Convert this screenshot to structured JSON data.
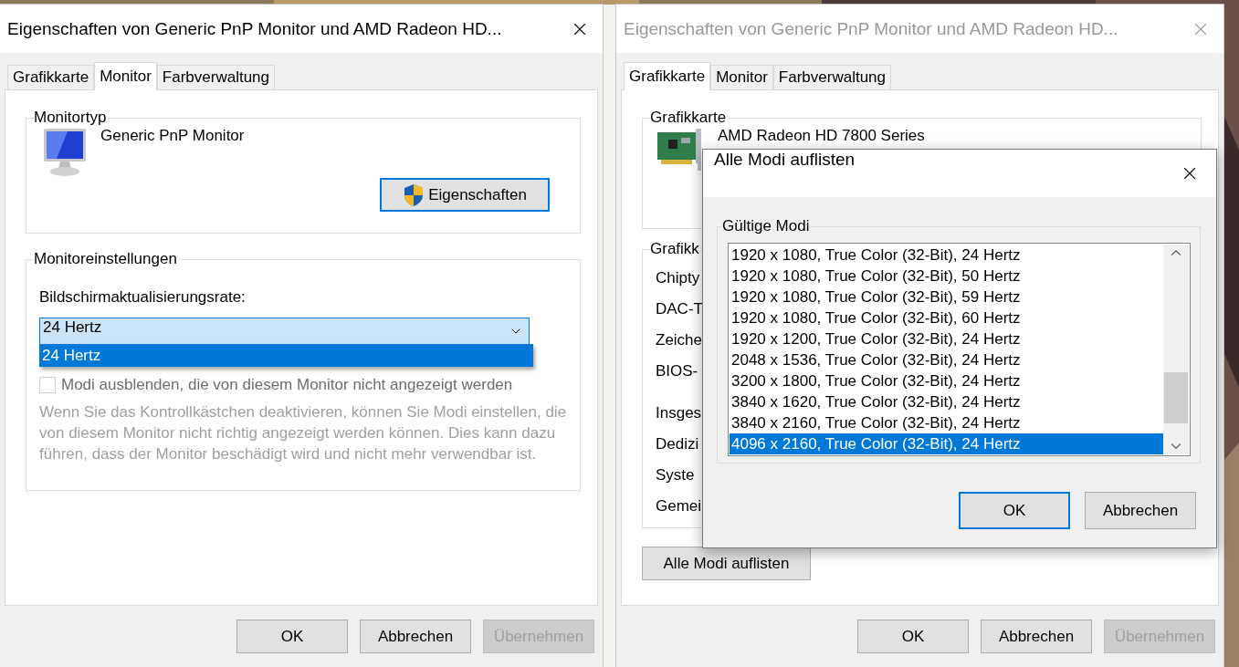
{
  "left_dialog": {
    "title": "Eigenschaften von Generic PnP Monitor und AMD Radeon HD...",
    "active": true,
    "tabs": [
      {
        "label": "Grafikkarte",
        "selected": false
      },
      {
        "label": "Monitor",
        "selected": true
      },
      {
        "label": "Farbverwaltung",
        "selected": false
      }
    ],
    "monitor_type": {
      "heading": "Monitortyp",
      "name": "Generic PnP Monitor",
      "button": {
        "label": "Eigenschaften",
        "focused": true
      }
    },
    "monitor_settings": {
      "heading": "Monitoreinstellungen",
      "refresh_label": "Bildschirmaktualisierungsrate:",
      "refresh_dropdown": {
        "value": "24 Hertz",
        "expanded": true,
        "options": [
          {
            "label": "24 Hertz",
            "selected": true
          }
        ]
      },
      "hide_modes": {
        "label": "Modi ausblenden, die von diesem Monitor nicht angezeigt werden",
        "checked": false,
        "disabled": true
      },
      "note": "Wenn Sie das Kontrollkästchen deaktivieren, können Sie Modi einstellen, die von diesem Monitor nicht richtig angezeigt werden können. Dies kann dazu führen, dass der Monitor beschädigt wird und nicht mehr verwendbar ist."
    },
    "buttons": [
      {
        "label": "OK",
        "disabled": false
      },
      {
        "label": "Abbrechen",
        "disabled": false
      },
      {
        "label": "Übernehmen",
        "disabled": true
      }
    ]
  },
  "right_dialog": {
    "title": "Eigenschaften von Generic PnP Monitor und AMD Radeon HD...",
    "active": false,
    "tabs": [
      {
        "label": "Grafikkarte",
        "selected": true
      },
      {
        "label": "Monitor",
        "selected": false
      },
      {
        "label": "Farbverwaltung",
        "selected": false
      }
    ],
    "adapter_group": {
      "heading": "Grafikkarte",
      "name": "AMD Radeon HD 7800 Series"
    },
    "info_group": {
      "heading": "Grafikk",
      "chip_labels": [
        "Chipty",
        "DAC-T",
        "Zeiche",
        "BIOS-"
      ],
      "memory_labels": [
        "Insges",
        "Dedizi",
        "Syste",
        "Gemei"
      ]
    },
    "list_modes_button": "Alle Modi auflisten",
    "buttons": [
      {
        "label": "OK",
        "disabled": false
      },
      {
        "label": "Abbrechen",
        "disabled": false
      },
      {
        "label": "Übernehmen",
        "disabled": true
      }
    ],
    "modal": {
      "title": "Alle Modi auflisten",
      "group": "Gültige Modi",
      "modes": [
        {
          "label": "1920 x 1080, True Color (32-Bit), 24 Hertz",
          "selected": false
        },
        {
          "label": "1920 x 1080, True Color (32-Bit), 50 Hertz",
          "selected": false
        },
        {
          "label": "1920 x 1080, True Color (32-Bit), 59 Hertz",
          "selected": false
        },
        {
          "label": "1920 x 1080, True Color (32-Bit), 60 Hertz",
          "selected": false
        },
        {
          "label": "1920 x 1200, True Color (32-Bit), 24 Hertz",
          "selected": false
        },
        {
          "label": "2048 x 1536, True Color (32-Bit), 24 Hertz",
          "selected": false
        },
        {
          "label": "3200 x 1800, True Color (32-Bit), 24 Hertz",
          "selected": false
        },
        {
          "label": "3840 x 1620, True Color (32-Bit), 24 Hertz",
          "selected": false
        },
        {
          "label": "3840 x 2160, True Color (32-Bit), 24 Hertz",
          "selected": false
        },
        {
          "label": "4096 x 2160, True Color (32-Bit), 24 Hertz",
          "selected": true
        }
      ],
      "buttons": [
        {
          "label": "OK",
          "focused": true
        },
        {
          "label": "Abbrechen",
          "focused": false
        }
      ]
    }
  }
}
